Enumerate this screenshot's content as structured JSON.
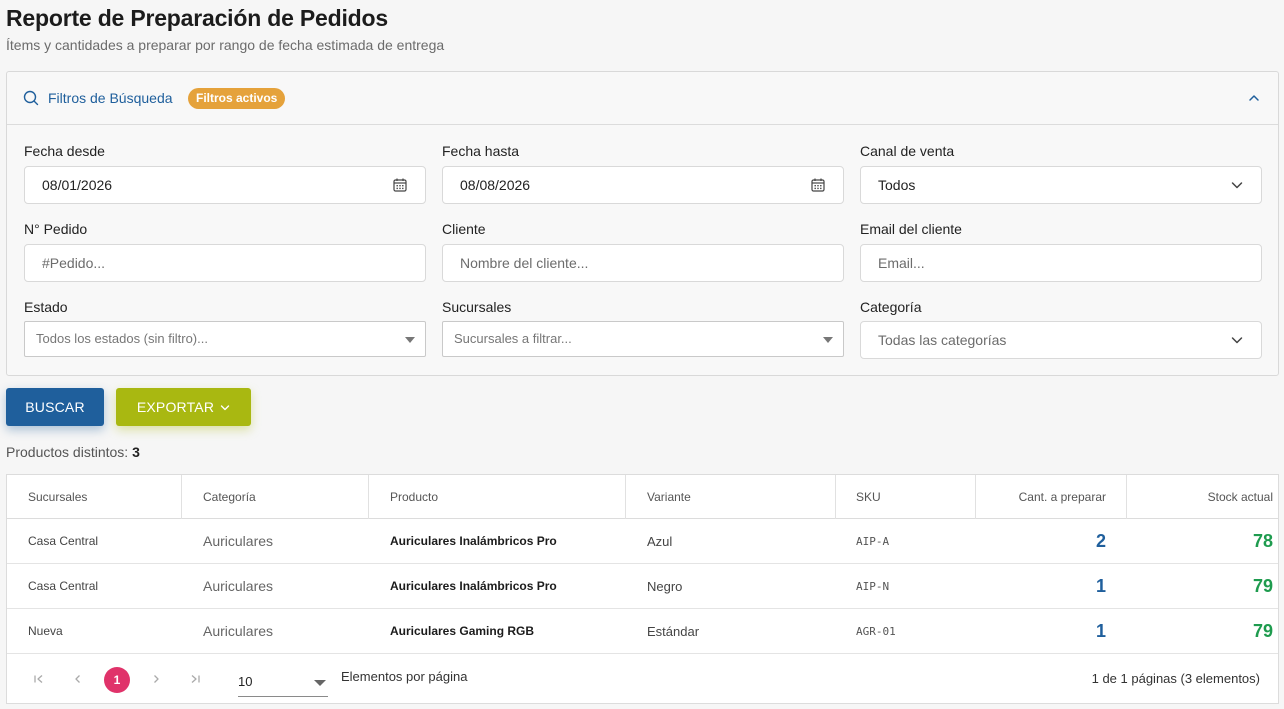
{
  "header": {
    "title": "Reporte de Preparación de Pedidos",
    "subtitle": "Ítems y cantidades a preparar por rango de fecha estimada de entrega"
  },
  "filters": {
    "title": "Filtros de Búsqueda",
    "badge": "Filtros activos",
    "fecha_desde": {
      "label": "Fecha desde",
      "value": "08/01/2026"
    },
    "fecha_hasta": {
      "label": "Fecha hasta",
      "value": "08/08/2026"
    },
    "canal": {
      "label": "Canal de venta",
      "value": "Todos"
    },
    "pedido": {
      "label": "N° Pedido",
      "placeholder": "#Pedido..."
    },
    "cliente": {
      "label": "Cliente",
      "placeholder": "Nombre del cliente..."
    },
    "email": {
      "label": "Email del cliente",
      "placeholder": "Email..."
    },
    "estado": {
      "label": "Estado",
      "placeholder": "Todos los estados (sin filtro)..."
    },
    "sucursales": {
      "label": "Sucursales",
      "placeholder": "Sucursales a filtrar..."
    },
    "categoria": {
      "label": "Categoría",
      "placeholder": "Todas las categorías"
    }
  },
  "actions": {
    "buscar": "BUSCAR",
    "exportar": "EXPORTAR"
  },
  "summary": {
    "label": "Productos distintos:",
    "count": "3"
  },
  "table": {
    "columns": [
      "Sucursales",
      "Categoría",
      "Producto",
      "Variante",
      "SKU",
      "Cant. a preparar",
      "Stock actual"
    ],
    "rows": [
      {
        "sucursal": "Casa Central",
        "categoria": "Auriculares",
        "producto": "Auriculares Inalámbricos Pro",
        "variante": "Azul",
        "sku": "AIP-A",
        "cantidad": "2",
        "stock": "78"
      },
      {
        "sucursal": "Casa Central",
        "categoria": "Auriculares",
        "producto": "Auriculares Inalámbricos Pro",
        "variante": "Negro",
        "sku": "AIP-N",
        "cantidad": "1",
        "stock": "79"
      },
      {
        "sucursal": "Nueva",
        "categoria": "Auriculares",
        "producto": "Auriculares Gaming RGB",
        "variante": "Estándar",
        "sku": "AGR-01",
        "cantidad": "1",
        "stock": "79"
      }
    ]
  },
  "pagination": {
    "current_page": "1",
    "page_size": "10",
    "page_size_label": "Elementos por página",
    "info": "1 de 1 páginas (3 elementos)"
  },
  "colors": {
    "primary": "#1f5f9c",
    "export": "#a9b811",
    "badge": "#e5a23b",
    "stock": "#1e9b4e",
    "pager_active": "#e0336a"
  },
  "icons": {
    "search": "search-icon",
    "collapse": "chevron-up-icon",
    "calendar": "calendar-icon",
    "dropdown": "chevron-down-icon",
    "first": "first-page-icon",
    "prev": "prev-page-icon",
    "next": "next-page-icon",
    "last": "last-page-icon"
  }
}
